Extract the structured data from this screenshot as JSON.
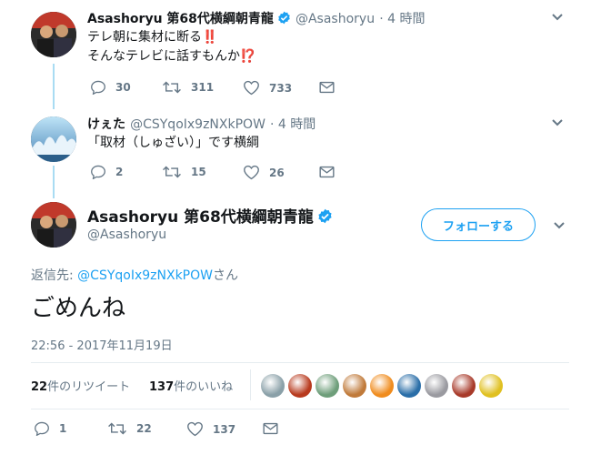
{
  "original_tweet": {
    "display_name": "Asashoryu 第68代横綱朝青龍",
    "handle": "@Asashoryu",
    "time": "· 4 時間",
    "line1": "テレ朝に集材に断る",
    "line1_emoji": "‼️",
    "line2": "そんなテレビに話すもんか",
    "line2_emoji": "⁉️",
    "replies": "30",
    "retweets": "311",
    "likes": "733"
  },
  "reply_tweet": {
    "display_name": "けぇた",
    "handle": "@CSYqoIx9zNXkPOW",
    "time": "· 4 時間",
    "text": "「取材（しゅざい）」です横綱",
    "replies": "2",
    "retweets": "15",
    "likes": "26"
  },
  "main_tweet": {
    "display_name": "Asashoryu 第68代横綱朝青龍",
    "handle": "@Asashoryu",
    "follow_label": "フォローする",
    "reply_to_prefix": "返信先: ",
    "reply_to_handle": "@CSYqoIx9zNXkPOW",
    "reply_to_suffix": "さん",
    "text": "ごめんね",
    "timestamp": "22:56 - 2017年11月19日",
    "retweet_count": "22",
    "retweet_label": "件のリツイート",
    "like_count": "137",
    "like_label": "件のいいね",
    "actions": {
      "replies": "1",
      "retweets": "22",
      "likes": "137"
    }
  },
  "icons": {
    "verified": "verified-badge-icon",
    "reply": "reply-icon",
    "retweet": "retweet-icon",
    "like": "heart-icon",
    "dm": "envelope-icon",
    "more": "chevron-down-icon"
  },
  "colors": {
    "accent": "#1da1f2",
    "thread_line": "#a9dcf3",
    "muted": "#657786",
    "text": "#14171a"
  },
  "likers": [
    "#8aa0a8",
    "#b83a1e",
    "#6e9e7a",
    "#c07a3a",
    "#f08c1e",
    "#2a6ea8",
    "#9a9aa0",
    "#a83a2a",
    "#e0c020"
  ]
}
